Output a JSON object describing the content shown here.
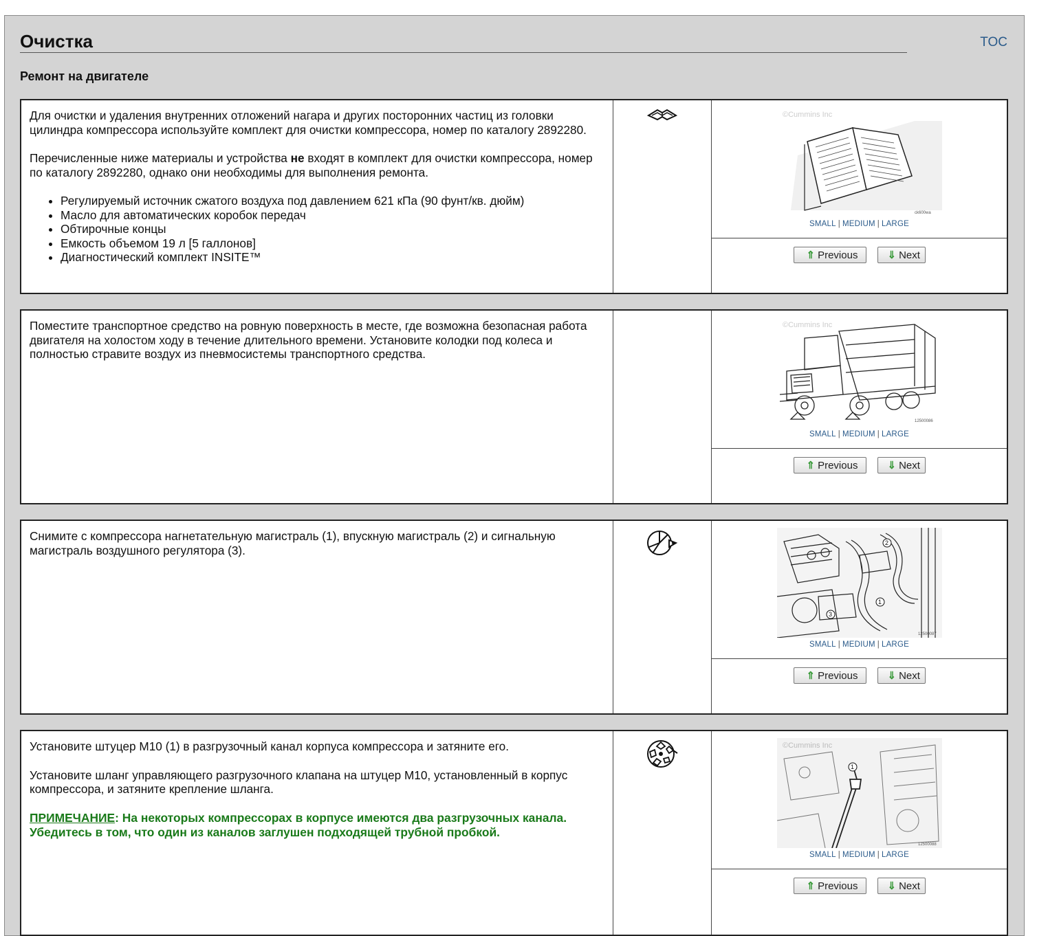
{
  "header": {
    "title": "Очистка",
    "toc_label": "TOC",
    "subtitle": "Ремонт на двигателе"
  },
  "media_labels": {
    "small": "SMALL",
    "separator": "|",
    "medium": "MEDIUM",
    "large": "LARGE",
    "previous": "Previous",
    "next": "Next"
  },
  "colors": {
    "frame_bg": "#d4d4d4",
    "link_blue": "#2a5a8a",
    "note_green": "#1a7a1a",
    "arrow_green": "#3a9a3a"
  },
  "steps": [
    {
      "icon": "manual-book-icon",
      "illustration": "open-catalog-book",
      "watermark": "©Cummins Inc",
      "figure_code": "ck600wa",
      "p1": "Для очистки и удаления внутренних отложений нагара и других посторонних частиц из головки цилиндра компрессора используйте комплект для очистки компрессора, номер по каталогу 2892280.",
      "p2_before": "Перечисленные ниже материалы и устройства ",
      "p2_bold": "не",
      "p2_after": " входят в комплект для очистки компрессора, номер по каталогу 2892280, однако они необходимы для выполнения ремонта.",
      "bullets": [
        "Регулируемый источник сжатого воздуха под давлением 621 кПа (90 фунт/кв. дюйм)",
        "Масло для автоматических коробок передач",
        "Обтирочные концы",
        "Емкость объемом 19 л [5 галлонов]",
        "Диагностический комплект INSITE™"
      ]
    },
    {
      "illustration": "garbage-truck-with-wheel-chocks",
      "watermark": "©Cummins Inc",
      "figure_code": "12500086",
      "p1": "Поместите транспортное средство на ровную поверхность в месте, где возможна безопасная работа двигателя на холостом ходу в течение длительного времени. Установите колодки под колеса и полностью стравите воздух из пневмосистемы транспортного средства."
    },
    {
      "icon": "remove-part-icon",
      "illustration": "compressor-lines-callouts-1-2-3",
      "figure_code": "12500087",
      "p1": "Снимите с компрессора нагнетательную магистраль (1), впускную магистраль (2) и сигнальную магистраль воздушного регулятора (3)."
    },
    {
      "icon": "install-part-icon",
      "illustration": "fitting-m10-callout-1",
      "watermark": "©Cummins Inc",
      "figure_code": "12500088",
      "p1": "Установите штуцер M10 (1) в разгрузочный канал корпуса компрессора и затяните его.",
      "p2": "Установите шланг управляющего разгрузочного клапана на штуцер M10, установленный в корпус компрессора, и затяните крепление шланга.",
      "note_label": "ПРИМЕЧАНИЕ",
      "note_colon": ":",
      "note_text": " На некоторых компрессорах в корпусе имеются два разгрузочных канала. Убедитесь в том, что один из каналов заглушен подходящей трубной пробкой."
    }
  ]
}
